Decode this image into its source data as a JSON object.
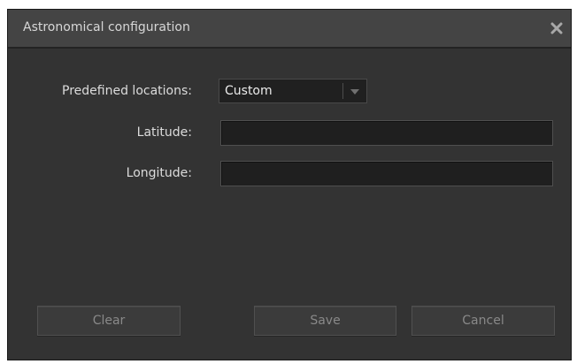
{
  "dialog": {
    "title": "Astronomical configuration",
    "close_icon": "close-icon"
  },
  "form": {
    "predefined_locations_label": "Predefined locations:",
    "predefined_locations_value": "Custom",
    "dropdown_icon": "chevron-down-icon",
    "latitude_label": "Latitude:",
    "latitude_value": "",
    "longitude_label": "Longitude:",
    "longitude_value": ""
  },
  "buttons": {
    "clear_label": "Clear",
    "save_label": "Save",
    "cancel_label": "Cancel"
  },
  "colors": {
    "dialog_background": "#333333",
    "titlebar_background": "#444444",
    "field_background": "#1f1f1f",
    "button_background": "#3b3b3b",
    "button_text": "#898989",
    "label_text": "#dcdcdc"
  }
}
